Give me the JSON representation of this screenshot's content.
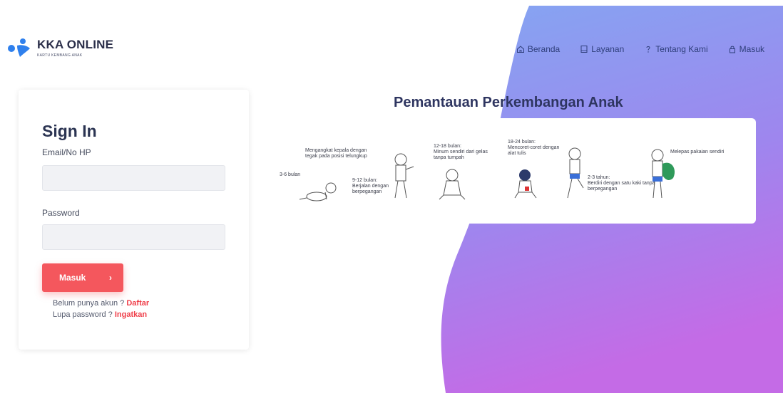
{
  "brand": {
    "name": "KKA ONLINE",
    "tagline": "KARTU KEMBANG ANAK",
    "color": "#2f80ed"
  },
  "nav": {
    "items": [
      {
        "label": "Beranda",
        "icon": "home-icon"
      },
      {
        "label": "Layanan",
        "icon": "book-icon"
      },
      {
        "label": "Tentang Kami",
        "icon": "question-icon"
      },
      {
        "label": "Masuk",
        "icon": "lock-icon"
      }
    ]
  },
  "signin": {
    "title": "Sign In",
    "email_label": "Email/No HP",
    "email_value": "",
    "password_label": "Password",
    "password_value": "",
    "submit_label": "Masuk",
    "register_prompt": "Belum punya akun ?",
    "register_link": "Daftar",
    "forgot_prompt": "Lupa password ?",
    "forgot_link": "Ingatkan"
  },
  "panel": {
    "title": "Pemantauan Perkembangan Anak",
    "stages": [
      {
        "age": "3-6 bulan",
        "desc": ""
      },
      {
        "age": "",
        "desc": "Mengangkat kepala dengan tegak pada posisi telungkup"
      },
      {
        "age": "9-12 bulan:",
        "desc": "Berjalan dengan berpegangan"
      },
      {
        "age": "12-18 bulan:",
        "desc": "Minum sendiri dari gelas tanpa tumpah"
      },
      {
        "age": "18-24 bulan:",
        "desc": "Mencoret-coret dengan alat tulis"
      },
      {
        "age": "2-3 tahun:",
        "desc": "Berdiri dengan satu kaki tanpa berpegangan"
      },
      {
        "age": "",
        "desc": "Melepas pakaian sendiri"
      }
    ]
  },
  "colors": {
    "accent": "#f4575d",
    "gradient_top": "#7fa6f2",
    "gradient_bottom": "#b56ee8",
    "heading": "#2e3560"
  }
}
